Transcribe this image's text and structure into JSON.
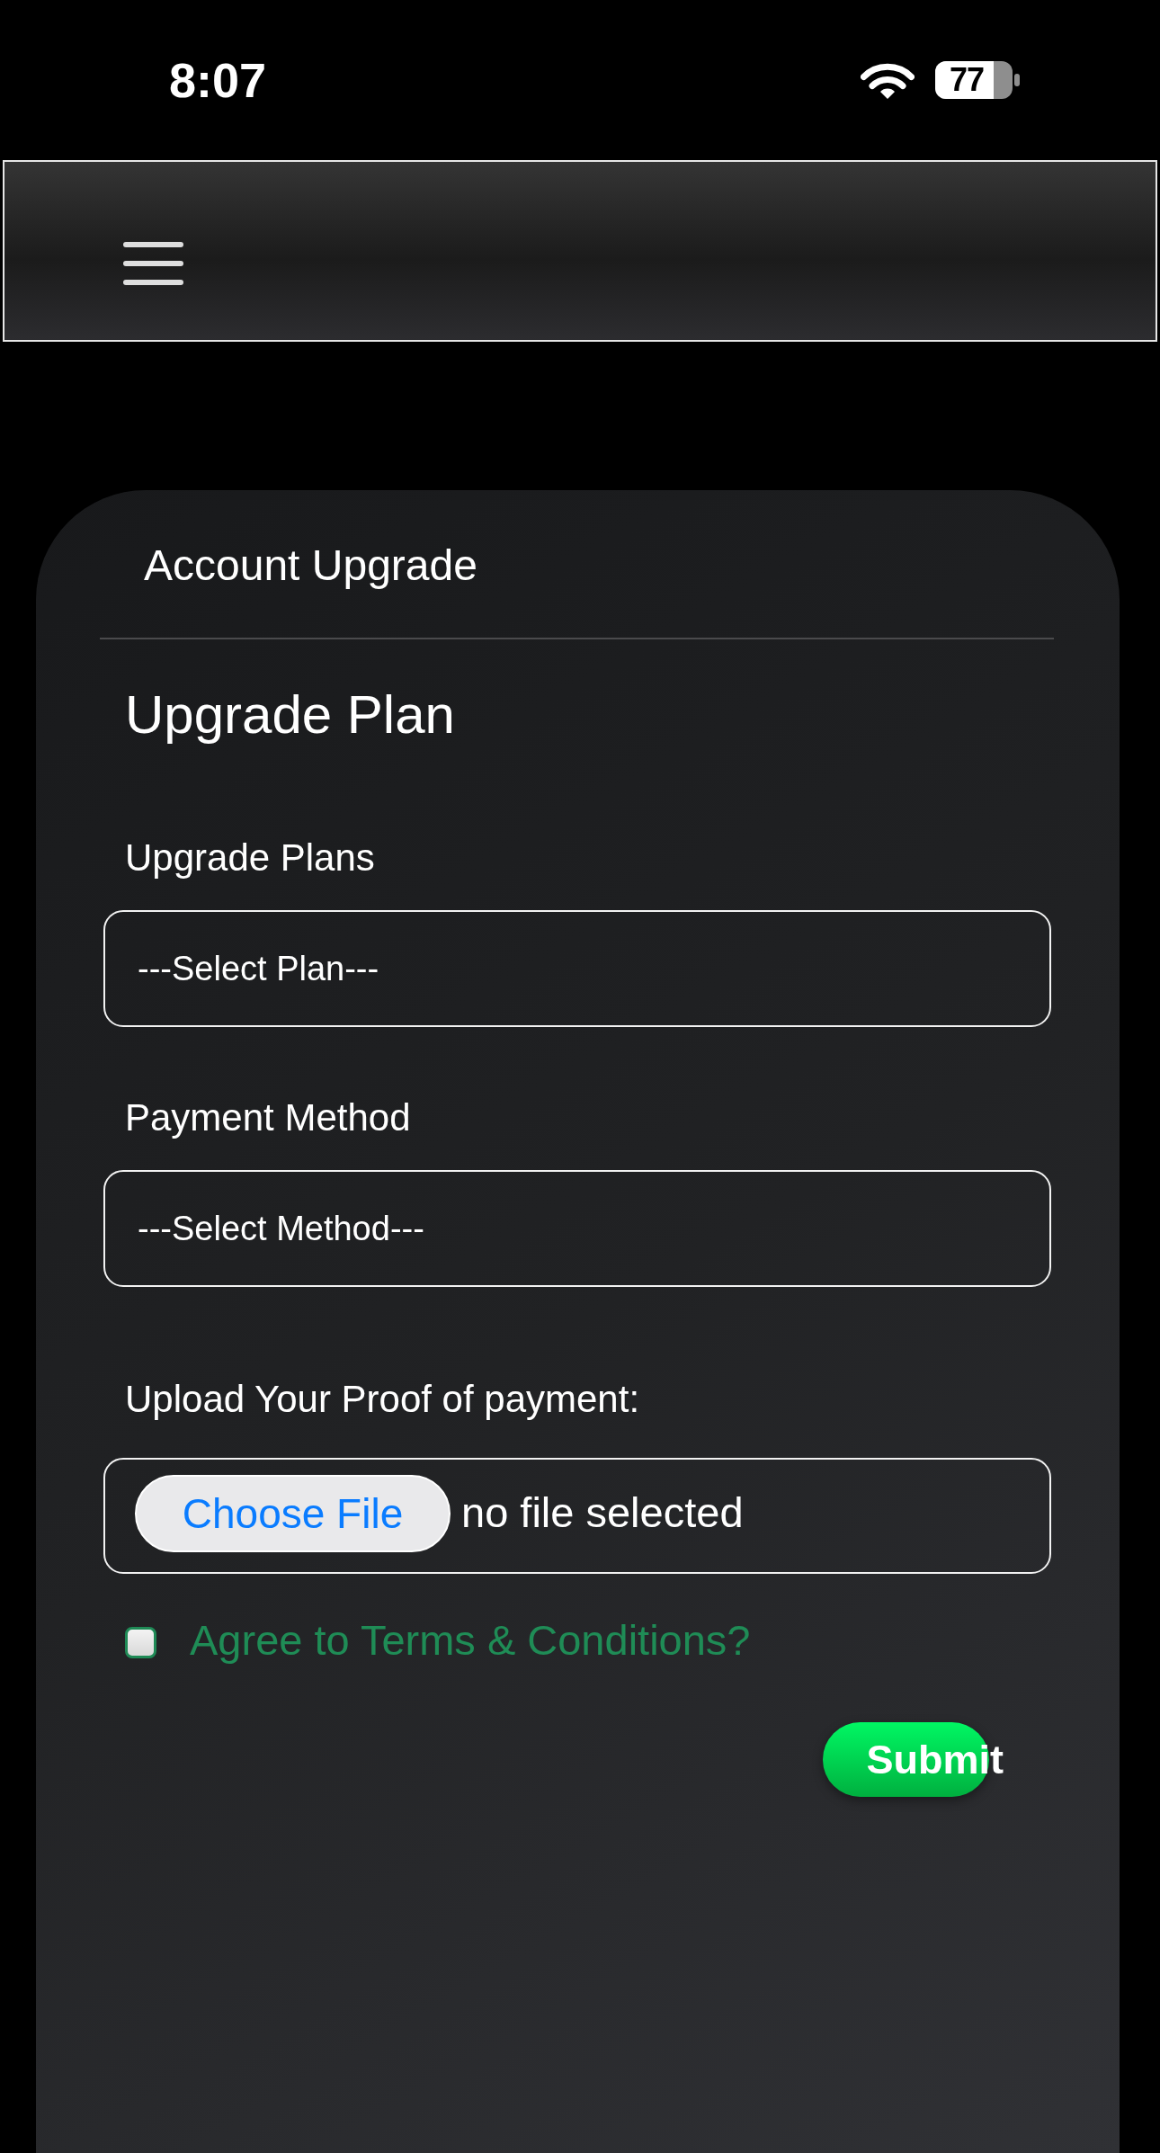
{
  "status_bar": {
    "time": "8:07",
    "battery": "77"
  },
  "card": {
    "title": "Account Upgrade"
  },
  "form": {
    "heading": "Upgrade Plan",
    "fields": [
      {
        "kind": "select",
        "label": "Upgrade Plans",
        "value": "---Select Plan---"
      },
      {
        "kind": "select",
        "label": "Payment Method",
        "value": "---Select Method---"
      },
      {
        "kind": "file",
        "label": "Upload Your Proof of payment:",
        "button": "Choose File",
        "value": "no file selected"
      }
    ],
    "terms": {
      "label": "Agree to Terms & Conditions?",
      "checked": false
    },
    "submit": "Submit"
  }
}
